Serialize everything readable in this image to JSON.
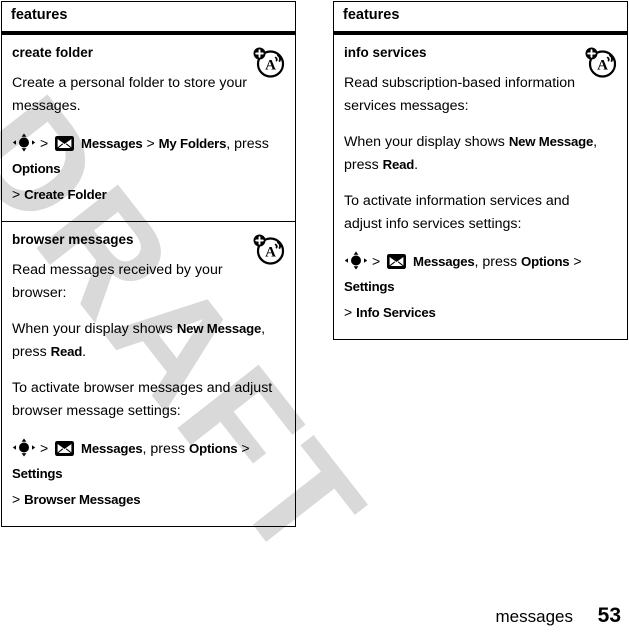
{
  "watermark": {
    "text": "DRAFT",
    "color": "#d9d9d9"
  },
  "footer": {
    "chapter": "messages",
    "page_number": "53"
  },
  "tables": [
    {
      "id": "left",
      "header": "features",
      "rows": [
        {
          "title": "create folder",
          "icon": "cell-broadcast-icon",
          "paragraphs": [
            {
              "type": "text",
              "text": "Create a personal folder to store your messages."
            }
          ],
          "path": {
            "line1_prefix": "",
            "items": [
              {
                "kind": "nav-icon",
                "name": "navigation-key-icon"
              },
              {
                "kind": "sep",
                "text": ">"
              },
              {
                "kind": "msg-icon",
                "name": "messages-envelope-icon"
              },
              {
                "kind": "screen",
                "text": "Messages"
              },
              {
                "kind": "sep",
                "text": ">"
              },
              {
                "kind": "screen",
                "text": "My Folders"
              },
              {
                "kind": "plain",
                "text": ", press "
              },
              {
                "kind": "screen",
                "text": "Options"
              },
              {
                "kind": "sep",
                "text": ">"
              },
              {
                "kind": "screen",
                "text": "Create Folder"
              }
            ]
          }
        },
        {
          "title": "browser messages",
          "icon": "cell-broadcast-icon",
          "paragraphs": [
            {
              "type": "text",
              "text": "Read messages received by your browser:"
            },
            {
              "type": "rich",
              "pre": "When your display shows ",
              "screen1": "New Message",
              "mid": ", press ",
              "screen2": "Read",
              "post": "."
            },
            {
              "type": "text",
              "text": "To activate browser messages and adjust browser message settings:"
            }
          ],
          "path": {
            "items": [
              {
                "kind": "nav-icon",
                "name": "navigation-key-icon"
              },
              {
                "kind": "sep",
                "text": ">"
              },
              {
                "kind": "msg-icon",
                "name": "messages-envelope-icon"
              },
              {
                "kind": "screen",
                "text": "Messages"
              },
              {
                "kind": "plain",
                "text": ", press "
              },
              {
                "kind": "screen",
                "text": "Options"
              },
              {
                "kind": "sep",
                "text": ">"
              },
              {
                "kind": "screen",
                "text": "Settings"
              },
              {
                "kind": "sep",
                "text": ">"
              },
              {
                "kind": "screen",
                "text": "Browser Messages"
              }
            ]
          }
        }
      ]
    },
    {
      "id": "right",
      "header": "features",
      "rows": [
        {
          "title": "info services",
          "icon": "cell-broadcast-icon",
          "paragraphs": [
            {
              "type": "text",
              "text": "Read subscription-based information services messages:"
            },
            {
              "type": "rich",
              "pre": "When your display shows ",
              "screen1": "New Message",
              "mid": ", press ",
              "screen2": "Read",
              "post": "."
            },
            {
              "type": "text",
              "text": "To activate information services and adjust info services settings:"
            }
          ],
          "path": {
            "items": [
              {
                "kind": "nav-icon",
                "name": "navigation-key-icon"
              },
              {
                "kind": "sep",
                "text": ">"
              },
              {
                "kind": "msg-icon",
                "name": "messages-envelope-icon"
              },
              {
                "kind": "screen",
                "text": "Messages"
              },
              {
                "kind": "plain",
                "text": ", press "
              },
              {
                "kind": "screen",
                "text": "Options"
              },
              {
                "kind": "sep",
                "text": ">"
              },
              {
                "kind": "screen",
                "text": "Settings"
              },
              {
                "kind": "sep",
                "text": ">"
              },
              {
                "kind": "screen",
                "text": "Info Services"
              }
            ]
          }
        }
      ]
    }
  ]
}
